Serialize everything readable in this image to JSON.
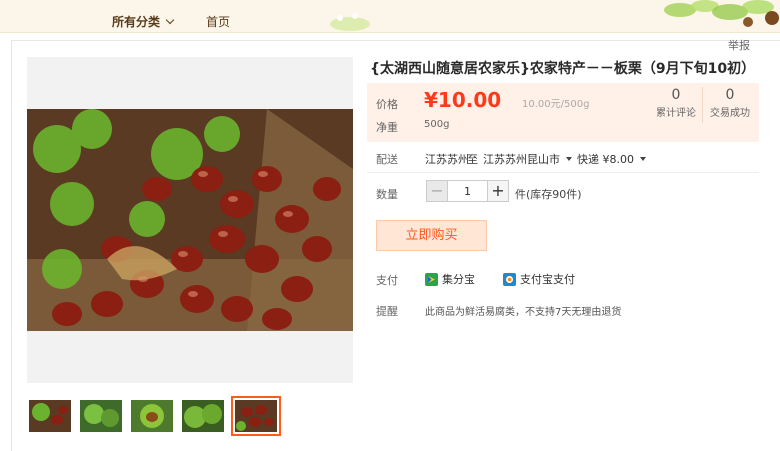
{
  "nav": {
    "category_label": "所有分类",
    "home_label": "首页"
  },
  "report_label": "举报",
  "product": {
    "title": "{太湖西山随意居农家乐}农家特产－－板栗（9月下旬10初）",
    "price_label": "价格",
    "price": "¥10.00",
    "unit_price": "10.00元/500g",
    "weight_label": "净重",
    "weight": "500g",
    "stats": [
      {
        "value": "0",
        "caption": "累计评论"
      },
      {
        "value": "0",
        "caption": "交易成功"
      }
    ]
  },
  "shipping": {
    "label": "配送",
    "from": "江苏苏州",
    "to_word": "至",
    "to": "江苏苏州昆山市",
    "method": "快递 ¥8.00"
  },
  "quantity": {
    "label": "数量",
    "value": "1",
    "minus": "−",
    "plus": "+",
    "stock_text": "件(库存90件)"
  },
  "buy_button": "立即购买",
  "payment": {
    "label": "支付",
    "options": [
      {
        "name": "集分宝",
        "icon": "jifenbao-icon",
        "color": "#2aa34a"
      },
      {
        "name": "支付宝支付",
        "icon": "alipay-icon",
        "color": "#1a8ad6"
      }
    ]
  },
  "notice": {
    "label": "提醒",
    "text": "此商品为鲜活易腐类，不支持7天无理由退货"
  },
  "thumbnails": [
    {
      "name": "chestnut-photo-1"
    },
    {
      "name": "chestnut-photo-2"
    },
    {
      "name": "chestnut-photo-3"
    },
    {
      "name": "chestnut-photo-4"
    },
    {
      "name": "chestnut-photo-5",
      "active": true
    }
  ],
  "colors": {
    "accent": "#ff3a1a",
    "price_bg": "#fff1e8",
    "buy_bg": "#ffe6d5",
    "nav_bg": "#fbf6e9"
  }
}
